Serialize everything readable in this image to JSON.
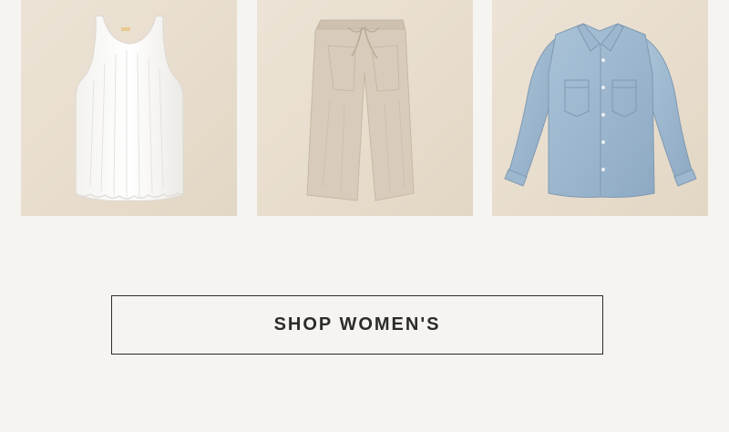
{
  "products": [
    {
      "name": "white-ribbed-tank-top",
      "image": "white-tank-image"
    },
    {
      "name": "linen-drawstring-pants",
      "image": "linen-pants-image"
    },
    {
      "name": "chambray-button-shirt",
      "image": "chambray-shirt-image"
    }
  ],
  "cta": {
    "label": "SHOP WOMEN'S"
  },
  "colors": {
    "page_background": "#f6f4f1",
    "tile_background": "#e8ddcd",
    "button_border": "#2b2b2b",
    "text": "#2b2b2b"
  }
}
